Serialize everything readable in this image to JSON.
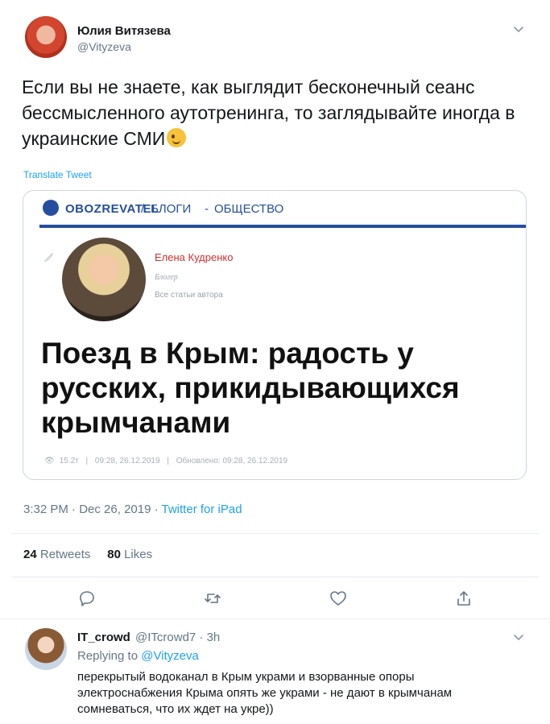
{
  "tweet": {
    "author_name": "Юлия Витязева",
    "author_handle": "@Vityzeva",
    "text": "Если вы не знаете, как выглядит бесконечный сеанс бессмысленного аутотренинга, то заглядывайте иногда в украинские СМИ",
    "translate_label": "Translate Tweet",
    "time": "3:32 PM",
    "date": "Dec 26, 2019",
    "source": "Twitter for iPad",
    "retweets_count": "24",
    "retweets_label": "Retweets",
    "likes_count": "80",
    "likes_label": "Likes"
  },
  "card": {
    "brand": "OBOZREVATEL",
    "separator": "/",
    "blogs": "БЛОГИ",
    "dash": "-",
    "section": "ОБЩЕСТВО",
    "author_name": "Елена Кудренко",
    "author_role": "Блогер",
    "all_posts": "Все статьи автора",
    "headline": "Поезд в Крым: радость у русских, прикидывающихся крымчанами",
    "views": "15.2т",
    "published": "09:28, 26.12.2019",
    "updated": "Обновлено: 09:28, 26.12.2019"
  },
  "reply": {
    "name": "IT_crowd",
    "handle_time": "@ITcrowd7 · 3h",
    "replying_label": "Replying to",
    "replying_to": "@Vityzeva",
    "text": "перекрытый водоканал в Крым украми и взорванные опоры электроснабжения Крыма опять же украми  - не дают в крымчанам сомневаться, что их ждет на укре))"
  },
  "colors": {
    "accent": "#1da1f2",
    "muted": "#657786",
    "obozrevatel_blue": "#254e9e",
    "author_red": "#d32f2f"
  },
  "icons": [
    "reply-icon",
    "retweet-icon",
    "like-icon",
    "share-icon",
    "chevron-down-icon",
    "wink-emoji-icon"
  ]
}
